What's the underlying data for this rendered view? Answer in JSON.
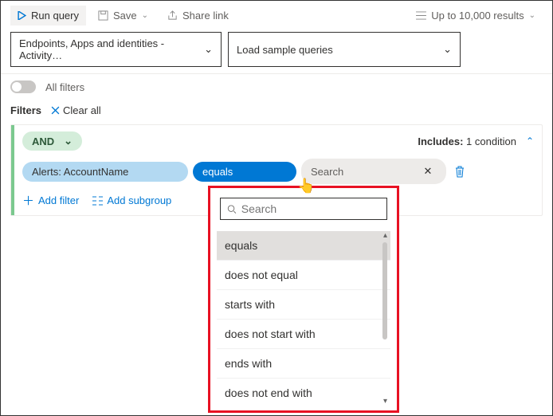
{
  "toolbar": {
    "run": "Run query",
    "save": "Save",
    "share": "Share link",
    "results": "Up to 10,000 results"
  },
  "selectors": {
    "left": "Endpoints, Apps and identities - Activity…",
    "right": "Load sample queries"
  },
  "filters": {
    "all_label": "All filters",
    "title": "Filters",
    "clear": "Clear all"
  },
  "group": {
    "logic": "AND",
    "includes_label": "Includes:",
    "includes_count": "1 condition",
    "field": "Alerts: AccountName",
    "op": "equals",
    "search_placeholder": "Search",
    "add_filter": "Add filter",
    "add_subgroup": "Add subgroup"
  },
  "dropdown": {
    "search_placeholder": "Search",
    "items": [
      "equals",
      "does not equal",
      "starts with",
      "does not start with",
      "ends with",
      "does not end with"
    ]
  }
}
